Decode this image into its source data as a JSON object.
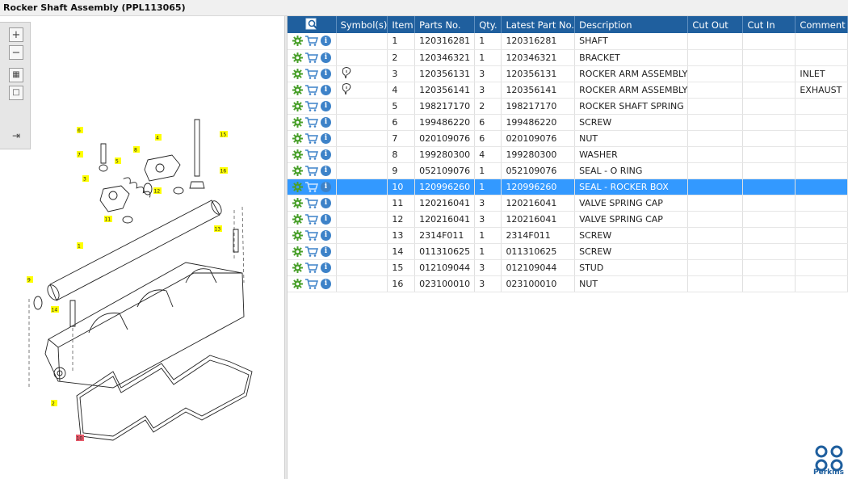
{
  "window": {
    "title": "Rocker Shaft Assembly (PPL113065)"
  },
  "toolbar": {
    "zoom_in_icon": "plus-icon",
    "zoom_out_icon": "minus-icon",
    "fit_icon": "grid-icon",
    "window_icon": "square-icon",
    "panel_icon": "panel-arrow-icon"
  },
  "table": {
    "headers": [
      "Symbol(s)",
      "Item",
      "Parts No.",
      "Qty.",
      "Latest Part No.",
      "Description",
      "Cut Out",
      "Cut In",
      "Comment"
    ],
    "header_icon": "search-list-icon",
    "selected_item": "10",
    "rows": [
      {
        "symbol": "",
        "item": "1",
        "part": "120316281",
        "qty": "1",
        "latest": "120316281",
        "desc": "SHAFT",
        "cut_out": "",
        "cut_in": "",
        "comment": ""
      },
      {
        "symbol": "",
        "item": "2",
        "part": "120346321",
        "qty": "1",
        "latest": "120346321",
        "desc": "BRACKET",
        "cut_out": "",
        "cut_in": "",
        "comment": ""
      },
      {
        "symbol": "pin",
        "item": "3",
        "part": "120356131",
        "qty": "3",
        "latest": "120356131",
        "desc": "ROCKER ARM ASSEMBLY",
        "cut_out": "",
        "cut_in": "",
        "comment": "INLET"
      },
      {
        "symbol": "pin",
        "item": "4",
        "part": "120356141",
        "qty": "3",
        "latest": "120356141",
        "desc": "ROCKER ARM ASSEMBLY",
        "cut_out": "",
        "cut_in": "",
        "comment": "EXHAUST"
      },
      {
        "symbol": "",
        "item": "5",
        "part": "198217170",
        "qty": "2",
        "latest": "198217170",
        "desc": "ROCKER SHAFT SPRING",
        "cut_out": "",
        "cut_in": "",
        "comment": ""
      },
      {
        "symbol": "",
        "item": "6",
        "part": "199486220",
        "qty": "6",
        "latest": "199486220",
        "desc": "SCREW",
        "cut_out": "",
        "cut_in": "",
        "comment": ""
      },
      {
        "symbol": "",
        "item": "7",
        "part": "020109076",
        "qty": "6",
        "latest": "020109076",
        "desc": "NUT",
        "cut_out": "",
        "cut_in": "",
        "comment": ""
      },
      {
        "symbol": "",
        "item": "8",
        "part": "199280300",
        "qty": "4",
        "latest": "199280300",
        "desc": "WASHER",
        "cut_out": "",
        "cut_in": "",
        "comment": ""
      },
      {
        "symbol": "",
        "item": "9",
        "part": "052109076",
        "qty": "1",
        "latest": "052109076",
        "desc": "SEAL - O RING",
        "cut_out": "",
        "cut_in": "",
        "comment": ""
      },
      {
        "symbol": "",
        "item": "10",
        "part": "120996260",
        "qty": "1",
        "latest": "120996260",
        "desc": "SEAL - ROCKER BOX",
        "cut_out": "",
        "cut_in": "",
        "comment": ""
      },
      {
        "symbol": "",
        "item": "11",
        "part": "120216041",
        "qty": "3",
        "latest": "120216041",
        "desc": "VALVE SPRING CAP",
        "cut_out": "",
        "cut_in": "",
        "comment": ""
      },
      {
        "symbol": "",
        "item": "12",
        "part": "120216041",
        "qty": "3",
        "latest": "120216041",
        "desc": "VALVE SPRING CAP",
        "cut_out": "",
        "cut_in": "",
        "comment": ""
      },
      {
        "symbol": "",
        "item": "13",
        "part": "2314F011",
        "qty": "1",
        "latest": "2314F011",
        "desc": "SCREW",
        "cut_out": "",
        "cut_in": "",
        "comment": ""
      },
      {
        "symbol": "",
        "item": "14",
        "part": "011310625",
        "qty": "1",
        "latest": "011310625",
        "desc": "SCREW",
        "cut_out": "",
        "cut_in": "",
        "comment": ""
      },
      {
        "symbol": "",
        "item": "15",
        "part": "012109044",
        "qty": "3",
        "latest": "012109044",
        "desc": "STUD",
        "cut_out": "",
        "cut_in": "",
        "comment": ""
      },
      {
        "symbol": "",
        "item": "16",
        "part": "023100010",
        "qty": "3",
        "latest": "023100010",
        "desc": "NUT",
        "cut_out": "",
        "cut_in": "",
        "comment": ""
      }
    ]
  },
  "diagram": {
    "callouts": [
      "1",
      "2",
      "3",
      "4",
      "5",
      "6",
      "7",
      "8",
      "9",
      "10",
      "11",
      "12",
      "13",
      "14",
      "15",
      "16"
    ],
    "highlighted_callout": "10",
    "callout_color": "#ffff00",
    "highlight_color": "#e85a6a"
  },
  "brand": {
    "name": "Perkins",
    "color": "#1f5f9e"
  },
  "colors": {
    "header_bg": "#1f5f9e",
    "selection_bg": "#3399ff",
    "gear": "#4aa02c",
    "cart": "#3d82c8"
  }
}
